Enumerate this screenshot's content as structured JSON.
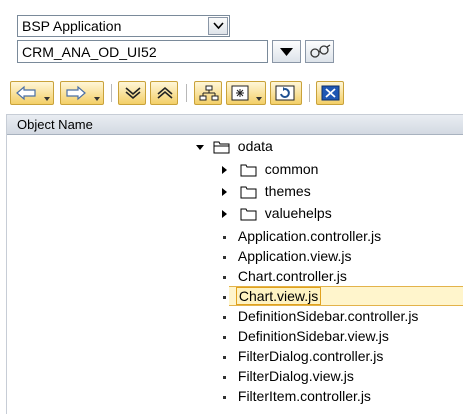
{
  "selector": {
    "type_value": "BSP Application",
    "object_value": "CRM_ANA_OD_UI52"
  },
  "toolbar": {
    "buttons": [
      "back-icon",
      "forward-icon",
      "expand-all-icon",
      "collapse-all-icon",
      "hierarchy-icon",
      "display-options-icon",
      "refresh-icon",
      "close-icon"
    ]
  },
  "tree": {
    "header": "Object Name",
    "root": "odata",
    "folders": [
      "common",
      "themes",
      "valuehelps"
    ],
    "files": [
      "Application.controller.js",
      "Application.view.js",
      "Chart.controller.js",
      "Chart.view.js",
      "DefinitionSidebar.controller.js",
      "DefinitionSidebar.view.js",
      "FilterDialog.controller.js",
      "FilterDialog.view.js",
      "FilterItem.controller.js"
    ],
    "selected": "Chart.view.js"
  },
  "colors": {
    "toolbar_button": "#f3cf68",
    "selection_border": "#e0a11e",
    "header_bg": "#d3d9e2"
  }
}
